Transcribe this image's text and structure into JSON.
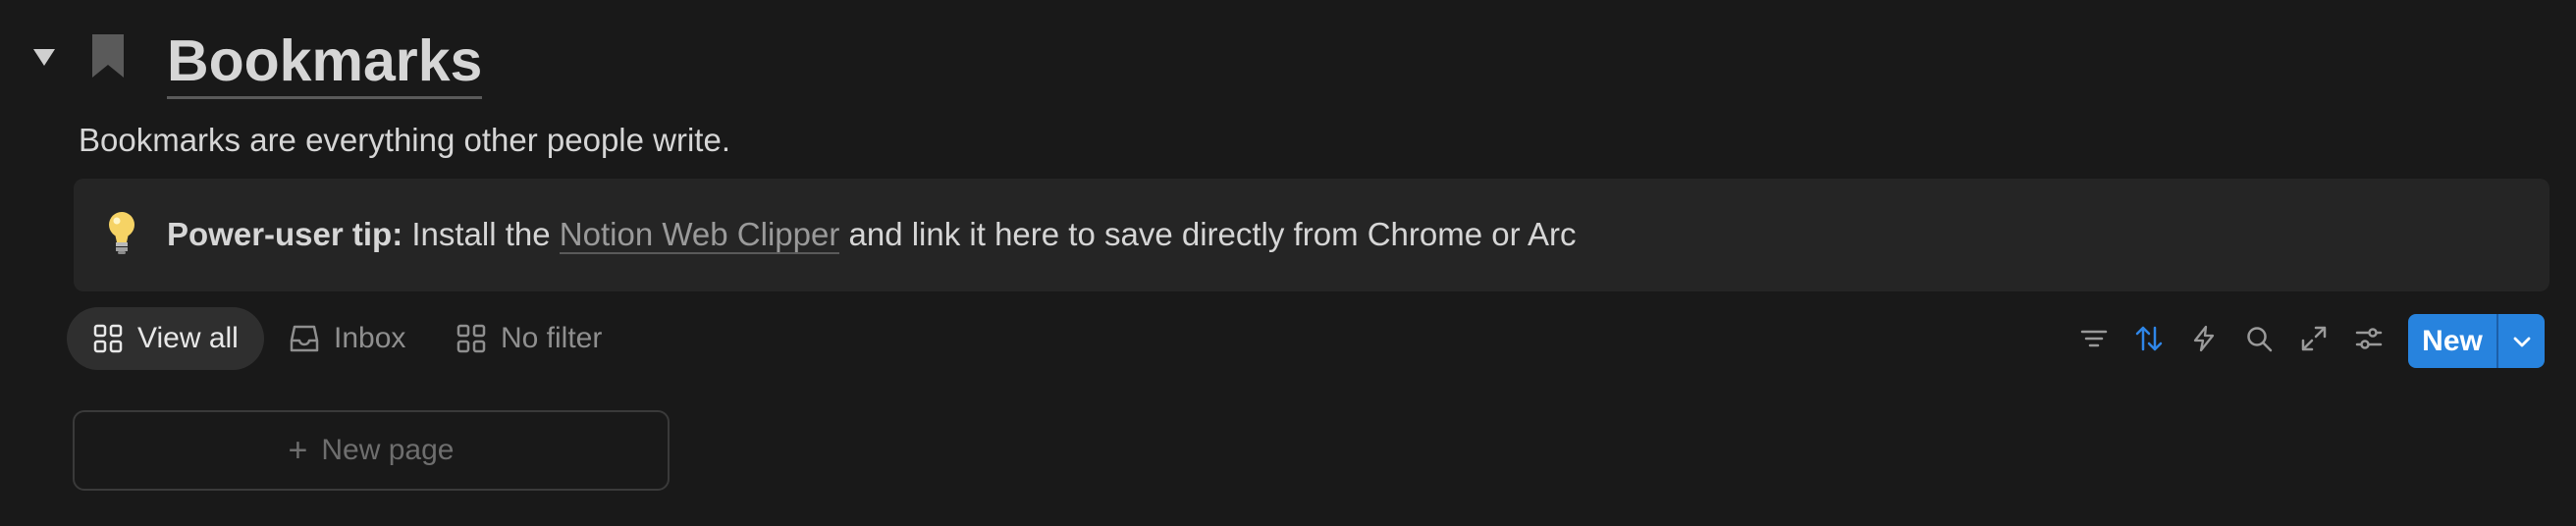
{
  "header": {
    "title": "Bookmarks",
    "description": "Bookmarks are everything other people write."
  },
  "callout": {
    "icon": "lightbulb-icon",
    "bold_prefix": "Power-user tip:",
    "text_before": " Install the ",
    "link_text": "Notion Web Clipper",
    "text_after": " and link it here to save directly from Chrome or Arc"
  },
  "tabs": [
    {
      "label": "View all",
      "icon": "grid-icon",
      "active": true
    },
    {
      "label": "Inbox",
      "icon": "inbox-icon",
      "active": false
    },
    {
      "label": "No filter",
      "icon": "grid-icon",
      "active": false
    }
  ],
  "toolbar": {
    "icons": [
      "filter-icon",
      "sort-icon",
      "lightning-icon",
      "search-icon",
      "expand-icon",
      "settings-sliders-icon"
    ],
    "new_label": "New"
  },
  "new_page": {
    "label": "New page"
  },
  "colors": {
    "background": "#191919",
    "accent": "#2783de",
    "callout_bg": "#252525",
    "sort_active": "#2f86e8"
  }
}
